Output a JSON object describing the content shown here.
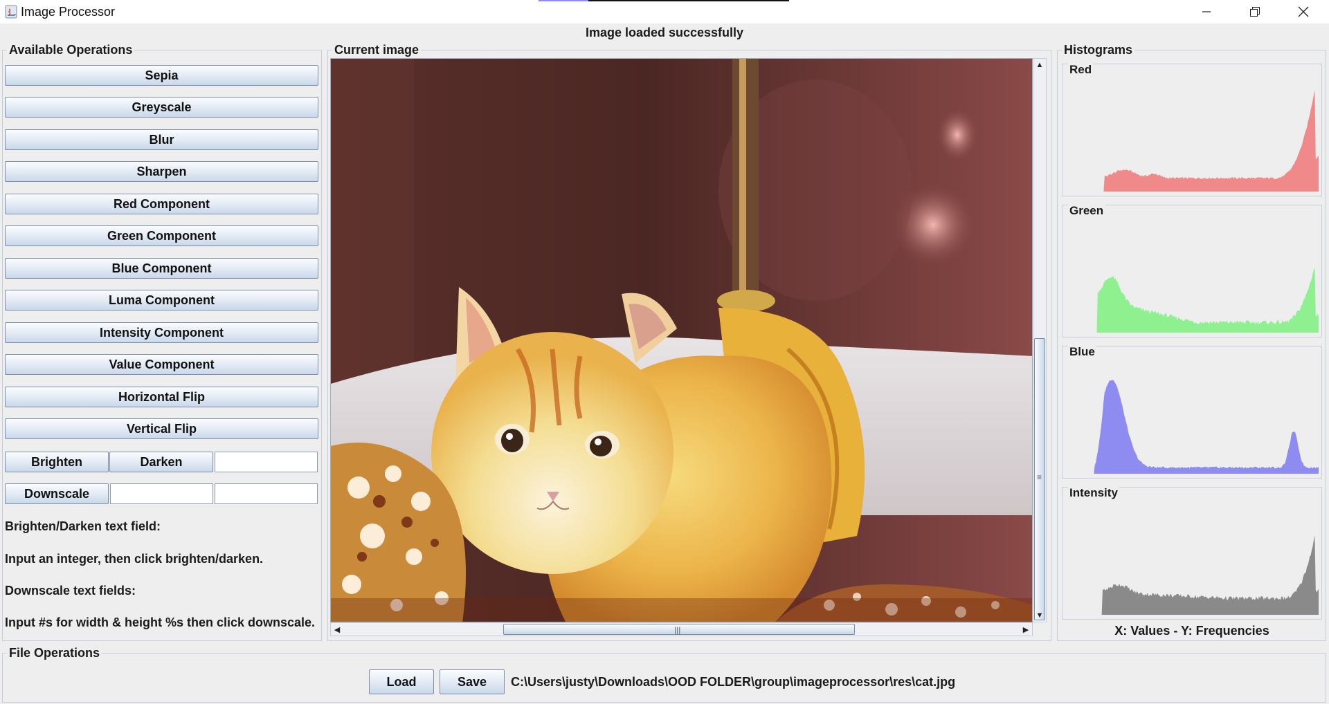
{
  "window": {
    "title": "Image Processor"
  },
  "status": "Image loaded successfully",
  "operations": {
    "title": "Available Operations",
    "buttons": [
      "Sepia",
      "Greyscale",
      "Blur",
      "Sharpen",
      "Red Component",
      "Green Component",
      "Blue Component",
      "Luma Component",
      "Intensity Component",
      "Value Component",
      "Horizontal Flip",
      "Vertical Flip"
    ],
    "brighten_label": "Brighten",
    "darken_label": "Darken",
    "brighten_value": "",
    "downscale_label": "Downscale",
    "downscale_width": "",
    "downscale_height": "",
    "help": [
      "Brighten/Darken text field:",
      "Input an integer, then click brighten/darken.",
      "Downscale text fields:",
      "Input #s for width & height %s then click downscale."
    ]
  },
  "image_panel": {
    "title": "Current image"
  },
  "histograms": {
    "title": "Histograms",
    "caption": "X: Values - Y: Frequencies",
    "items": [
      {
        "label": "Red",
        "color": "#f08a8a",
        "shape": [
          0,
          0,
          0,
          0,
          0,
          0,
          0,
          0,
          0,
          0,
          0,
          0,
          0,
          0,
          0,
          0,
          0,
          0,
          0,
          0,
          0,
          0,
          0,
          0,
          0,
          0,
          0,
          0,
          0,
          0,
          0,
          0,
          0,
          0,
          0,
          0,
          0,
          0,
          0,
          0,
          0,
          0,
          0,
          0,
          0,
          0,
          0,
          0,
          0,
          0,
          0,
          0,
          0,
          0,
          0,
          0,
          0,
          0,
          0,
          0,
          0,
          0,
          0,
          0,
          0,
          0,
          0,
          0,
          0,
          0,
          0,
          0,
          0,
          0,
          0,
          0,
          0,
          0,
          0,
          0,
          0,
          0,
          0,
          0,
          0,
          0,
          0,
          0,
          0,
          0,
          0,
          0,
          0,
          0,
          0,
          0,
          0,
          0,
          0,
          0,
          0,
          0,
          0,
          0,
          0,
          0,
          0,
          0,
          0,
          0,
          0,
          0,
          0,
          0,
          0,
          0,
          0,
          0,
          0,
          0,
          0,
          0,
          0,
          0,
          0,
          0,
          0,
          0,
          0,
          0,
          0,
          0,
          0,
          0,
          0,
          0,
          0,
          0,
          0,
          0,
          0,
          0,
          0,
          0,
          0,
          0,
          0,
          0,
          0,
          0,
          0,
          0,
          0,
          0,
          0,
          0,
          0,
          0,
          0,
          0,
          0,
          0,
          0,
          0,
          0,
          0,
          0,
          0,
          0,
          0,
          0,
          0,
          0,
          0,
          0,
          0,
          0,
          0,
          0,
          0,
          0,
          0,
          0,
          0,
          0,
          0,
          0,
          0,
          0,
          0,
          0,
          0,
          0,
          0,
          0,
          0,
          0,
          0,
          0,
          0,
          0,
          0,
          0,
          0,
          0,
          0,
          0,
          0,
          0,
          0,
          0,
          0,
          0,
          0,
          0,
          0,
          0,
          0,
          0,
          0,
          0,
          0,
          0,
          0,
          0,
          0,
          0,
          0,
          0,
          0,
          0,
          0,
          0,
          0,
          0,
          0,
          0,
          0,
          0,
          0,
          0,
          0,
          0,
          0,
          0,
          0,
          0,
          0,
          0,
          0,
          0,
          0,
          0,
          0,
          0,
          0
        ]
      },
      {
        "label": "Green",
        "color": "#8ef08e",
        "shape": []
      },
      {
        "label": "Blue",
        "color": "#8e8cf0",
        "shape": []
      },
      {
        "label": "Intensity",
        "color": "#8a8a8a",
        "shape": []
      }
    ]
  },
  "file_ops": {
    "title": "File Operations",
    "load_label": "Load",
    "save_label": "Save",
    "path": "C:\\Users\\justy\\Downloads\\OOD FOLDER\\group\\imageprocessor\\res\\cat.jpg"
  }
}
